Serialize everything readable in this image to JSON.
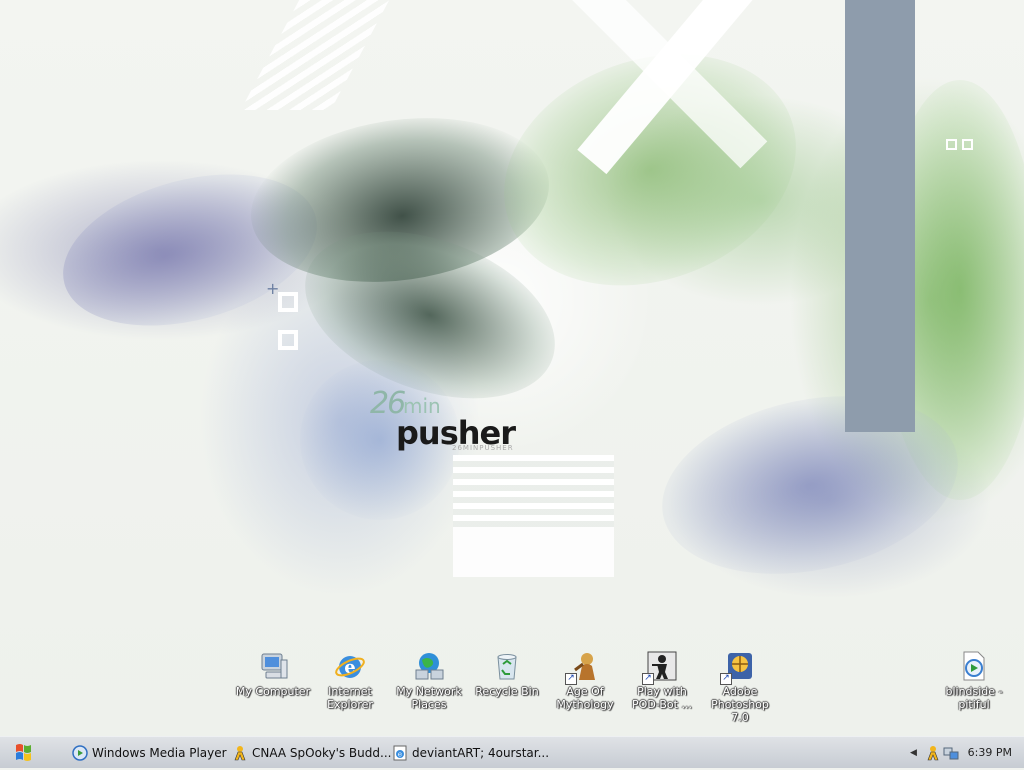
{
  "desktop": {
    "logo": {
      "number": "26",
      "small": "min",
      "main": "pusher",
      "sub": "26MINPUSHER"
    },
    "icons": [
      {
        "label": "My Computer",
        "icon": "my-computer-icon"
      },
      {
        "label": "Internet Explorer",
        "icon": "internet-explorer-icon"
      },
      {
        "label": "My Network Places",
        "icon": "network-places-icon"
      },
      {
        "label": "Recycle Bin",
        "icon": "recycle-bin-icon"
      },
      {
        "label": "Age Of Mythology",
        "icon": "age-of-mythology-icon"
      },
      {
        "label": "Play with POD-Bot ...",
        "icon": "counter-strike-icon"
      },
      {
        "label": "Adobe Photoshop 7.0",
        "icon": "photoshop-icon"
      },
      {
        "label": "blindside - pitiful",
        "icon": "media-file-icon"
      }
    ]
  },
  "taskbar": {
    "tasks": [
      {
        "label": "Windows Media Player",
        "icon": "windows-media-player-icon"
      },
      {
        "label": "CNAA SpOoky's Budd...",
        "icon": "aim-icon"
      },
      {
        "label": "deviantART; 4ourstar...",
        "icon": "ie-page-icon"
      }
    ],
    "tray": {
      "clock": "6:39 PM"
    }
  },
  "colors": {
    "taskbar": "#d4d8dd",
    "panel": "#8e9cac",
    "accent_green": "#6aa85a"
  }
}
